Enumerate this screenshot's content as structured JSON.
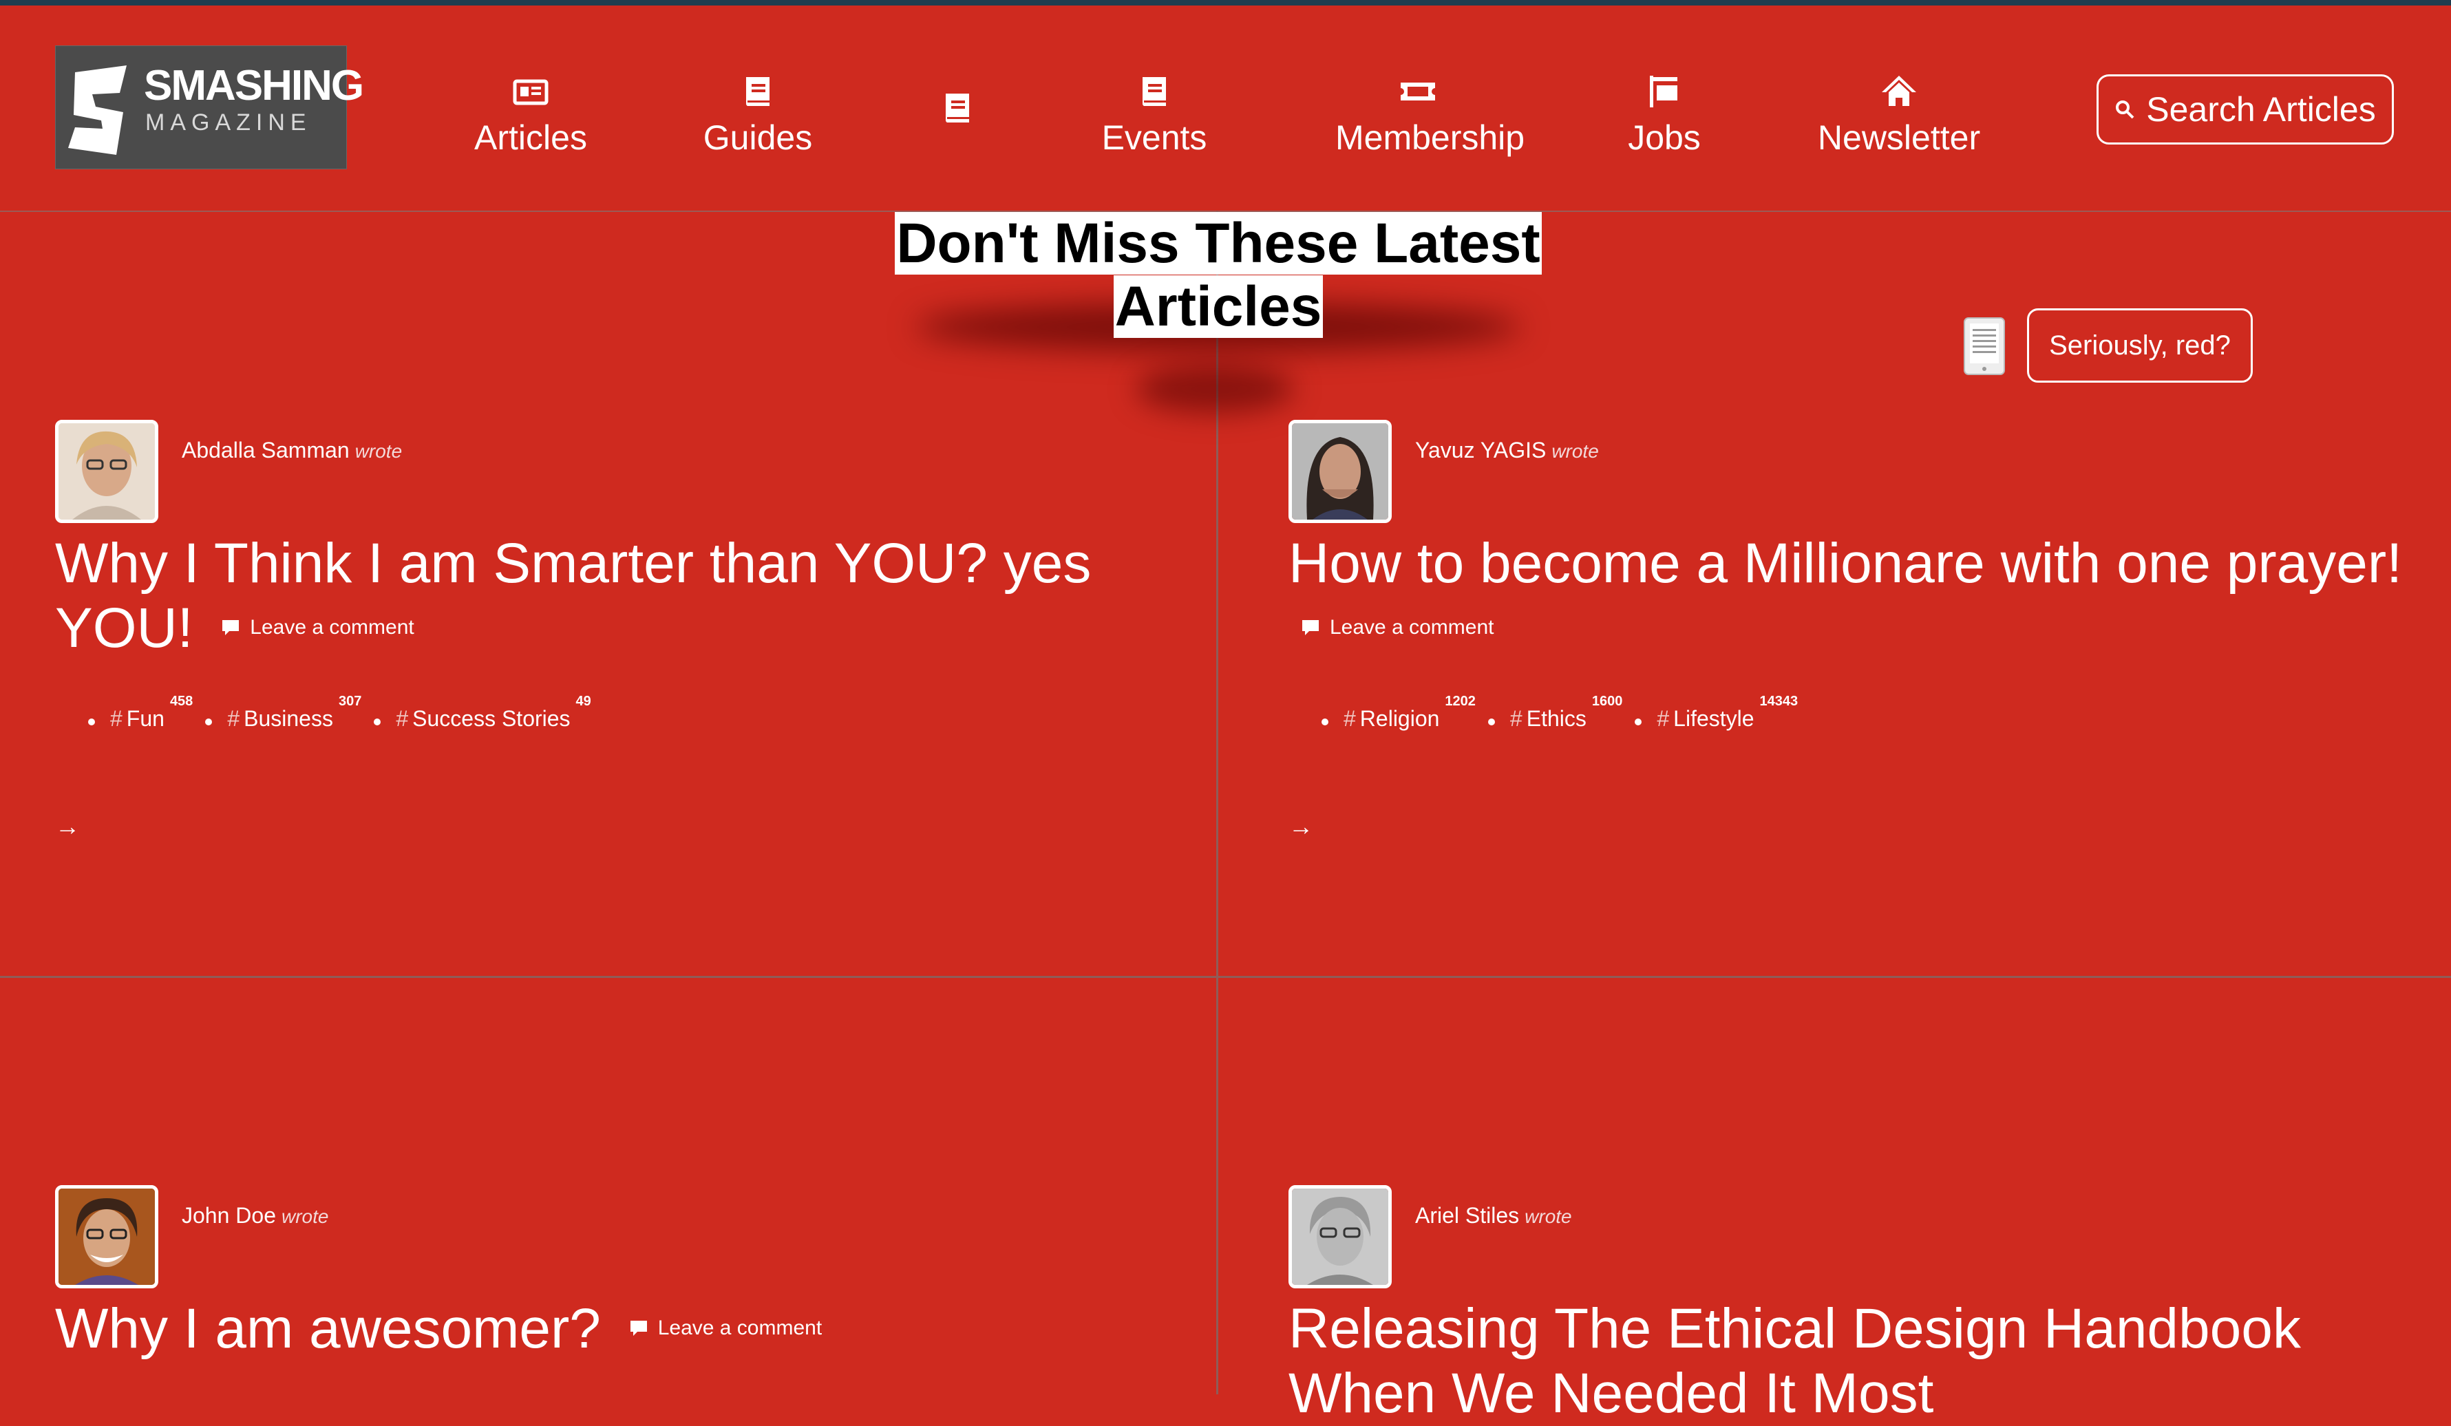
{
  "brand": {
    "line1": "SMASHING",
    "line2": "MAGAZINE"
  },
  "nav": [
    {
      "label": "Articles",
      "icon": "newspaper-icon"
    },
    {
      "label": "Guides",
      "icon": "book-icon"
    },
    {
      "label": "",
      "icon": "book-icon"
    },
    {
      "label": "Events",
      "icon": "book-icon"
    },
    {
      "label": "Membership",
      "icon": "ticket-icon"
    },
    {
      "label": "Jobs",
      "icon": "flag-icon"
    },
    {
      "label": "Newsletter",
      "icon": "home-icon"
    }
  ],
  "search": {
    "label": "Search Articles"
  },
  "heading": {
    "line1": "Don't Miss These Latest",
    "line2": "Articles"
  },
  "toggle": {
    "label": "Seriously, red?"
  },
  "articles": [
    {
      "author": "Abdalla Samman",
      "wrote": "wrote",
      "title": "Why I Think I am Smarter than YOU? yes YOU!",
      "comment": "Leave a comment",
      "tags": [
        {
          "name": "Fun",
          "count": "458"
        },
        {
          "name": "Business",
          "count": "307"
        },
        {
          "name": "Success Stories",
          "count": "49"
        }
      ],
      "arrow": "→"
    },
    {
      "author": "Yavuz YAGIS",
      "wrote": "wrote",
      "title": "How to become a Millionare with one prayer!",
      "comment": "Leave a comment",
      "tags": [
        {
          "name": "Religion",
          "count": "1202"
        },
        {
          "name": "Ethics",
          "count": "1600"
        },
        {
          "name": "Lifestyle",
          "count": "14343"
        }
      ],
      "arrow": "→"
    },
    {
      "author": "John Doe",
      "wrote": "wrote",
      "title": "Why I am awesomer?",
      "comment": "Leave a comment"
    },
    {
      "author": "Ariel Stiles",
      "wrote": "wrote",
      "title": "Releasing The Ethical Design Handbook When We Needed It Most"
    }
  ],
  "colors": {
    "background": "#cf2a1f",
    "topstrip": "#1f3d4f",
    "logo_bg": "#4b4b4b"
  }
}
